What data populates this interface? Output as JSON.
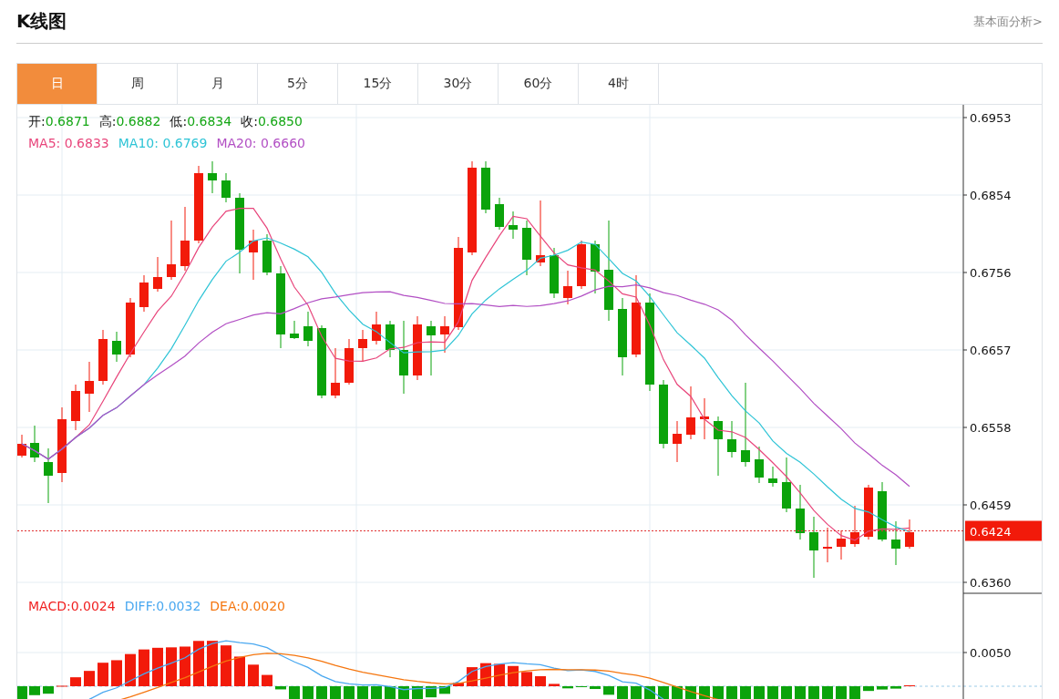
{
  "header": {
    "title": "K线图",
    "link": "基本面分析>"
  },
  "tabs": [
    {
      "label": "日",
      "selected": true
    },
    {
      "label": "周",
      "selected": false
    },
    {
      "label": "月",
      "selected": false
    },
    {
      "label": "5分",
      "selected": false
    },
    {
      "label": "15分",
      "selected": false
    },
    {
      "label": "30分",
      "selected": false
    },
    {
      "label": "60分",
      "selected": false
    },
    {
      "label": "4时",
      "selected": false
    }
  ],
  "ohlc": [
    {
      "label": "开:",
      "value": "0.6871"
    },
    {
      "label": "高:",
      "value": "0.6882"
    },
    {
      "label": "低:",
      "value": "0.6834"
    },
    {
      "label": "收:",
      "value": "0.6850"
    }
  ],
  "moving_averages": [
    {
      "label": "MA5:",
      "value": "0.6833",
      "color": "#e8457b"
    },
    {
      "label": "MA10:",
      "value": "0.6769",
      "color": "#2ec4d6"
    },
    {
      "label": "MA20:",
      "value": "0.6660",
      "color": "#b24fc4"
    }
  ],
  "price_axis": [
    "0.6953",
    "0.6854",
    "0.6756",
    "0.6657",
    "0.6558",
    "0.6459",
    "0.6360"
  ],
  "current_price": "0.6424",
  "macd_legend": [
    {
      "label": "MACD:",
      "value": "0.0024",
      "color": "#f01f1f"
    },
    {
      "label": "DIFF:",
      "value": "0.0032",
      "color": "#4aa8f0"
    },
    {
      "label": "DEA:",
      "value": "0.0020",
      "color": "#f5760f"
    }
  ],
  "macd_axis": [
    "0.0050"
  ]
}
